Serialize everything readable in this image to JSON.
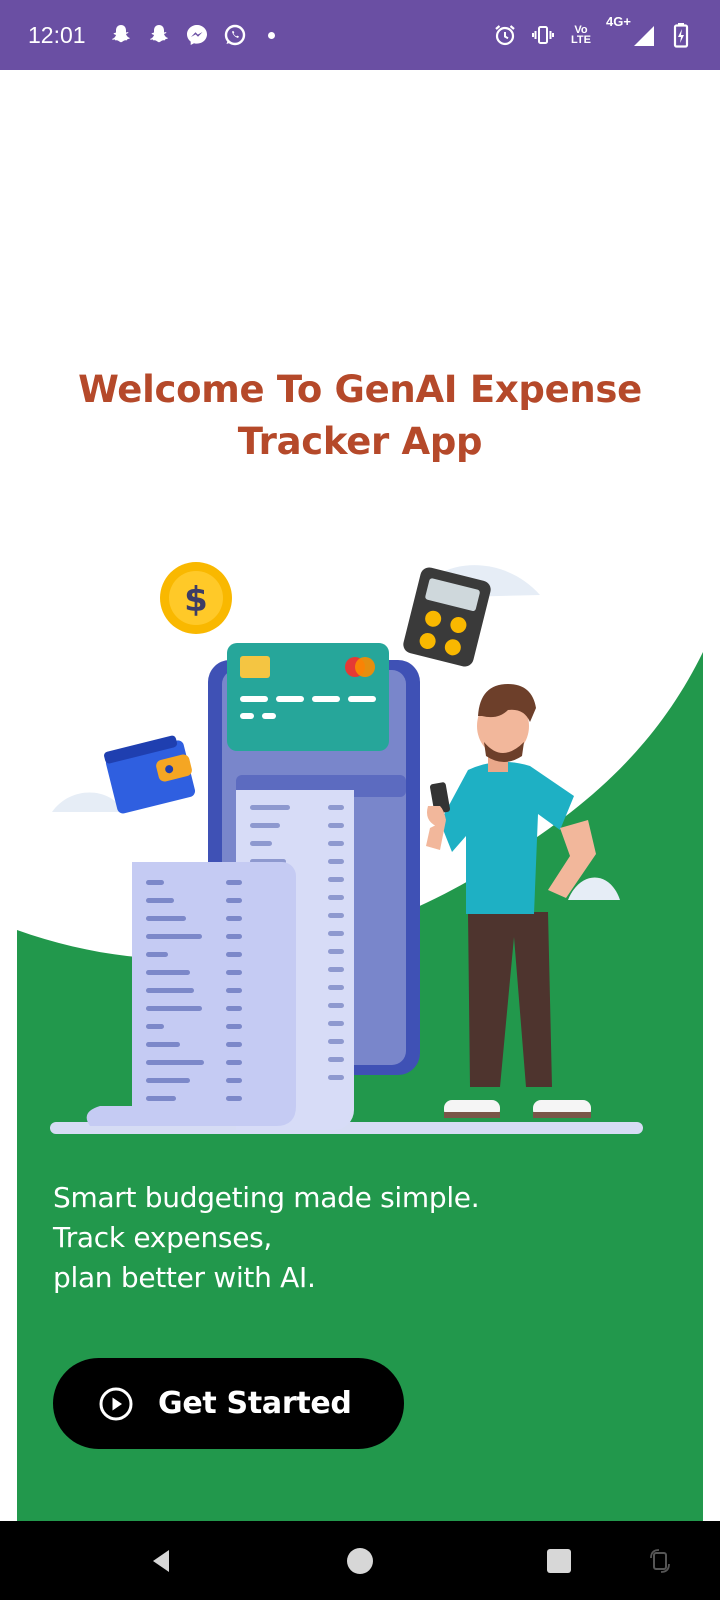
{
  "status_bar": {
    "time": "12:01",
    "left_icons": [
      "snapchat-icon",
      "snapchat-icon",
      "messenger-icon",
      "whatsapp-icon",
      "notification-dot"
    ],
    "right_icons": [
      "alarm-icon",
      "vibrate-icon",
      "volte-icon",
      "4g-signal-icon",
      "battery-icon"
    ],
    "volte_label_top": "Vo",
    "volte_label_bottom": "LTE",
    "network_label": "4G+"
  },
  "welcome": {
    "title_line1": "Welcome To GenAI Expense",
    "title_line2": "Tracker App"
  },
  "illustration": {
    "coin_symbol": "$"
  },
  "tagline": {
    "line1": "Smart budgeting made simple.",
    "line2": "Track expenses,",
    "line3": "plan better with AI."
  },
  "cta": {
    "label": "Get Started",
    "icon": "play-circle-icon"
  },
  "nav_bar": {
    "buttons": [
      "back-icon",
      "home-icon",
      "recents-icon",
      "rotate-icon"
    ]
  },
  "colors": {
    "status_bar": "#6a4fa3",
    "title": "#b5492a",
    "green_panel": "#22984c",
    "button": "#000000"
  }
}
